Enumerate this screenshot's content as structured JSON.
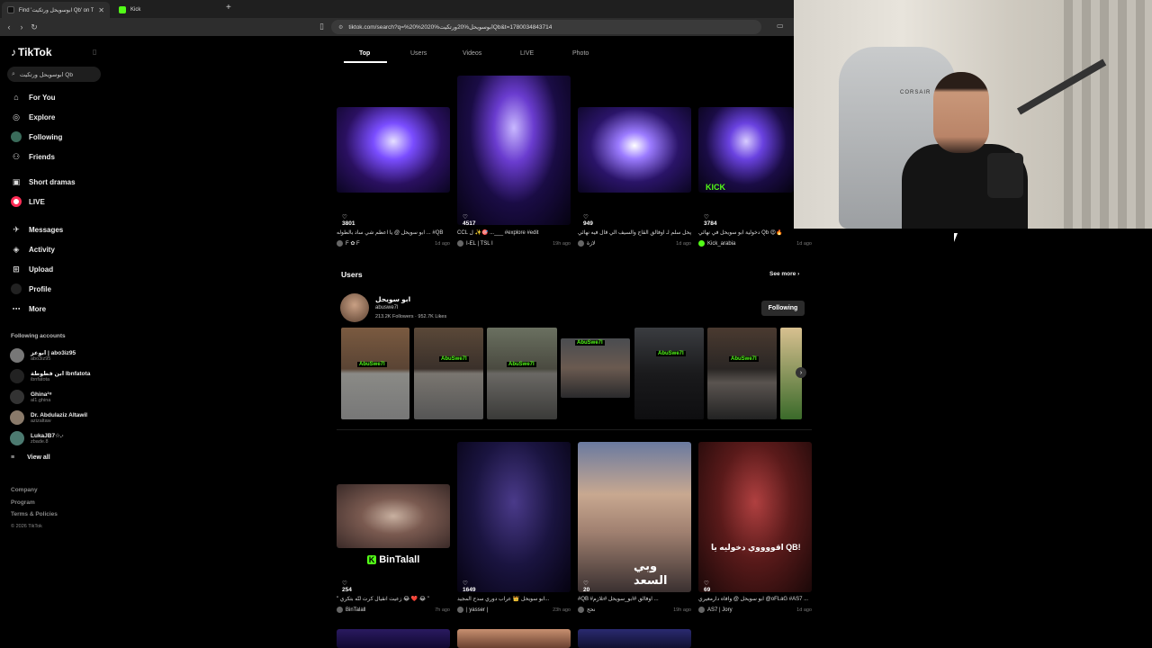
{
  "browser": {
    "tabs": [
      {
        "title": "Find 'ابوسويحل ورتكيت Qb' on TikTok",
        "active": true
      },
      {
        "title": "Kick",
        "active": false
      }
    ],
    "new_tab": "+",
    "url": "tiktok.com/search?q=%20%20ابوسويحل%20ورتكيت%20Qb&t=1780034843714"
  },
  "sidebar": {
    "logo": "TikTok",
    "search_value": "ابوسويحل ورتكيت Qb",
    "nav": [
      {
        "label": "For You",
        "icon": "home-icon"
      },
      {
        "label": "Explore",
        "icon": "compass-icon"
      },
      {
        "label": "Following",
        "icon": "following-avatar-icon"
      },
      {
        "label": "Friends",
        "icon": "friends-icon"
      },
      {
        "label": "Short dramas",
        "icon": "drama-icon"
      },
      {
        "label": "LIVE",
        "icon": "live-icon"
      },
      {
        "label": "Messages",
        "icon": "messages-icon",
        "badge": "9"
      },
      {
        "label": "Activity",
        "icon": "activity-icon"
      },
      {
        "label": "Upload",
        "icon": "upload-icon"
      },
      {
        "label": "Profile",
        "icon": "profile-avatar-icon"
      },
      {
        "label": "More",
        "icon": "more-icon"
      }
    ],
    "following_title": "Following accounts",
    "following": [
      {
        "name": "ابوعز | abo3iz95",
        "handle": "abo3iz95"
      },
      {
        "name": "ابن فطوطة Ibnfatota",
        "handle": "ibnfatota"
      },
      {
        "name": "Ghina²⁸",
        "handle": "al1.ghina"
      },
      {
        "name": "Dr. Abdulaziz Altawil",
        "handle": "azizaltaw"
      },
      {
        "name": "LukaJB7☆.·",
        "handle": "zbade.8"
      }
    ],
    "view_all": "View all",
    "footer": [
      "Company",
      "Program",
      "Terms & Policies"
    ],
    "copyright": "© 2026 TikTok"
  },
  "search_tabs": [
    "Top",
    "Users",
    "Videos",
    "LIVE",
    "Photo"
  ],
  "top_videos": [
    {
      "likes": "3801",
      "caption": "ابو سويحل @ يا اعظم شي ساد بالطوله ... #QB",
      "author": "F ✿ F",
      "age": "1d ago"
    },
    {
      "likes": "4517",
      "caption": "CCL ل ✨🎯 ...___ #explore #edit",
      "author": "I-EL | TSL I",
      "age": "19h ago"
    },
    {
      "likes": "949",
      "caption": "ابو سويحل سلم لـ اوفالق القاج والسيف الي قال فيه نهائي ...",
      "author": "لازة",
      "age": "1d ago"
    },
    {
      "likes": "3784",
      "caption": "دخولية ابو سويحل في نهائي Qb 😍🔥",
      "author": "Kick_arabia",
      "age": "1d ago"
    }
  ],
  "users_section": {
    "title": "Users",
    "see_more": "See more",
    "user": {
      "name": "ابو سويحل",
      "handle": "abuswe7l",
      "followers": "213.2K Followers",
      "likes": "952.7K Likes",
      "button": "Following"
    },
    "strip_labels": [
      "AbuSwe7l",
      "AbuSwe7l",
      "AbuSwe7l",
      "AbuSwe7l",
      "AbuSwe7l",
      "AbuSwe7l"
    ]
  },
  "bottom_videos": [
    {
      "likes": "254",
      "caption": "\" زعيت انقيال كرت لنّه بتكري 😂 ❤️ 😂 \"",
      "author": "BinTalall",
      "age": "7h ago",
      "overlay": "BinTalall"
    },
    {
      "likes": "1649",
      "caption": "ابو سويحل 👑 عراب دوري سدح المجيد...",
      "author": "| yasser |",
      "age": "23h ago",
      "overlay": ""
    },
    {
      "likes": "20",
      "caption": "#QB #اوفالق #ابو_سويحل #تلازم ...",
      "author": "نحح",
      "age": "19h ago",
      "overlay": "وبي السعد"
    },
    {
      "likes": "69",
      "caption": "ابو سويحل @ وافاه دارمعيري @oFLaG #AS7 ...",
      "author": "AS7 | Jory",
      "age": "1d ago",
      "overlay": "اقووووي دخوليه يا QB!"
    }
  ],
  "webcam": {
    "brand": "CORSAIR"
  }
}
